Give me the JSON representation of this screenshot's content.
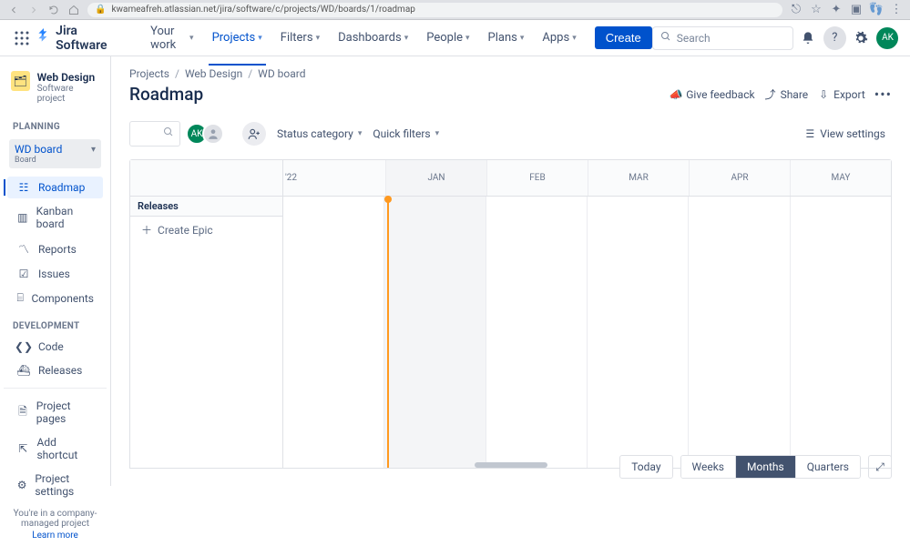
{
  "browser": {
    "url": "kwameafreh.atlassian.net/jira/software/c/projects/WD/boards/1/roadmap"
  },
  "top_nav": {
    "product": "Jira Software",
    "items": [
      "Your work",
      "Projects",
      "Filters",
      "Dashboards",
      "People",
      "Plans",
      "Apps"
    ],
    "active_index": 1,
    "create": "Create",
    "search_placeholder": "Search",
    "user_initials": "AK"
  },
  "sidebar": {
    "project_name": "Web Design",
    "project_type": "Software project",
    "planning_label": "PLANNING",
    "board_name": "WD board",
    "board_type": "Board",
    "planning_items": [
      {
        "label": "Roadmap",
        "icon": "roadmap",
        "active": true
      },
      {
        "label": "Kanban board",
        "icon": "board"
      },
      {
        "label": "Reports",
        "icon": "reports"
      }
    ],
    "base_items": [
      {
        "label": "Issues",
        "icon": "issues"
      },
      {
        "label": "Components",
        "icon": "components"
      }
    ],
    "dev_label": "DEVELOPMENT",
    "dev_items": [
      {
        "label": "Code",
        "icon": "code"
      },
      {
        "label": "Releases",
        "icon": "releases"
      }
    ],
    "bottom_items": [
      {
        "label": "Project pages",
        "icon": "pages"
      },
      {
        "label": "Add shortcut",
        "icon": "shortcut"
      },
      {
        "label": "Project settings",
        "icon": "settings"
      }
    ],
    "footer_text": "You're in a company-managed project",
    "footer_link": "Learn more"
  },
  "breadcrumbs": [
    "Projects",
    "Web Design",
    "WD board"
  ],
  "page": {
    "title": "Roadmap",
    "actions": {
      "feedback": "Give feedback",
      "share": "Share",
      "export": "Export"
    },
    "toolbar": {
      "status_category": "Status category",
      "quick_filters": "Quick filters",
      "view_settings": "View settings",
      "user_initials": "AK"
    },
    "timeline": {
      "year_label": "'22",
      "months": [
        "JAN",
        "FEB",
        "MAR",
        "APR",
        "MAY"
      ],
      "highlighted_month_index": 0,
      "releases_label": "Releases",
      "create_epic": "Create Epic"
    },
    "zoom": {
      "today": "Today",
      "scales": [
        "Weeks",
        "Months",
        "Quarters"
      ],
      "active_scale_index": 1
    }
  }
}
